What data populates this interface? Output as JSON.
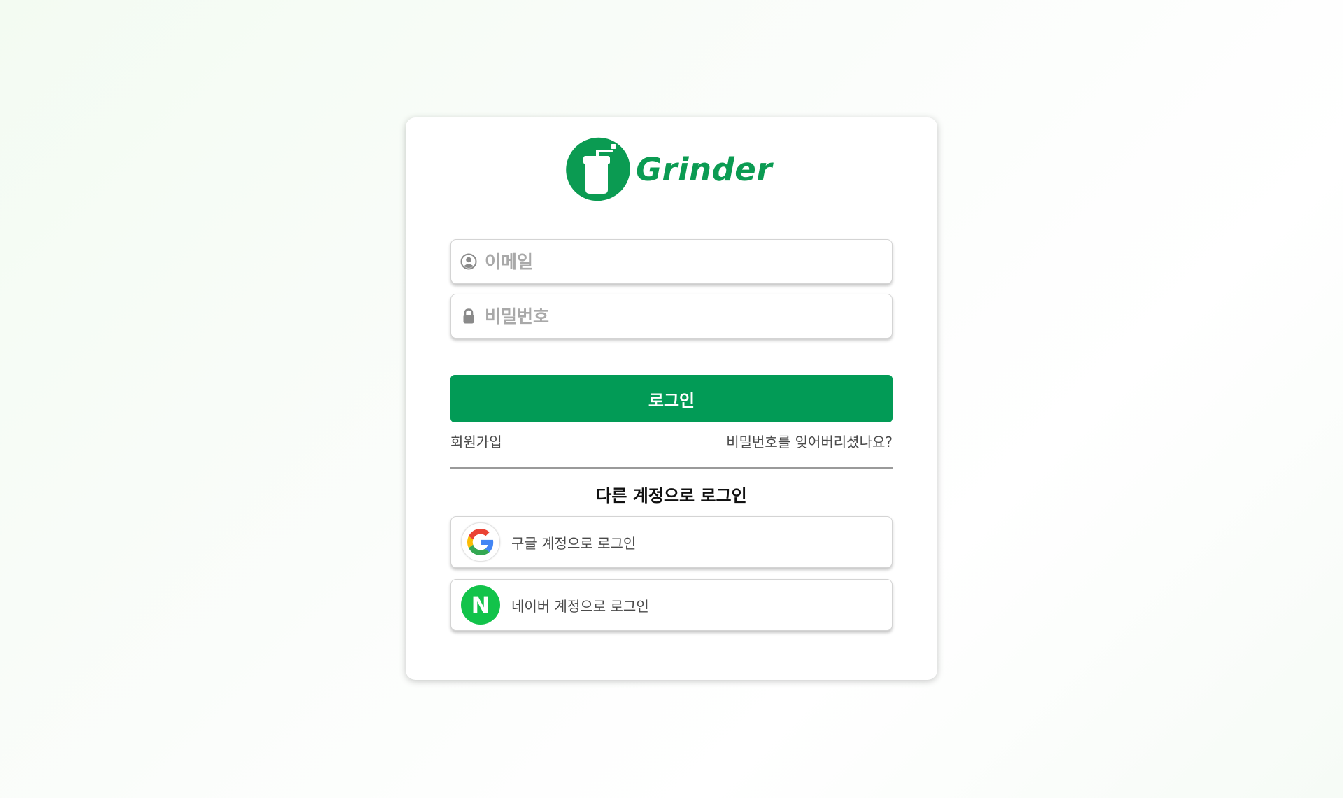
{
  "brand": {
    "name": "Grinder",
    "color": "#0b9b52",
    "logo_icon": "coffee-grinder-icon"
  },
  "form": {
    "email": {
      "placeholder": "이메일",
      "value": "",
      "icon": "user-circle-icon"
    },
    "password": {
      "placeholder": "비밀번호",
      "value": "",
      "icon": "lock-icon"
    },
    "login_label": "로그인",
    "login_color": "#029b56",
    "signup_label": "회원가입",
    "forgot_label": "비밀번호를 잊어버리셨나요?"
  },
  "alt_login": {
    "title": "다른 계정으로 로그인",
    "google_label": "구글 계정으로 로그인",
    "google_icon": "google-icon",
    "naver_label": "네이버 계정으로 로그인",
    "naver_icon": "naver-icon",
    "naver_icon_letter": "N",
    "naver_color": "#12c34a"
  }
}
